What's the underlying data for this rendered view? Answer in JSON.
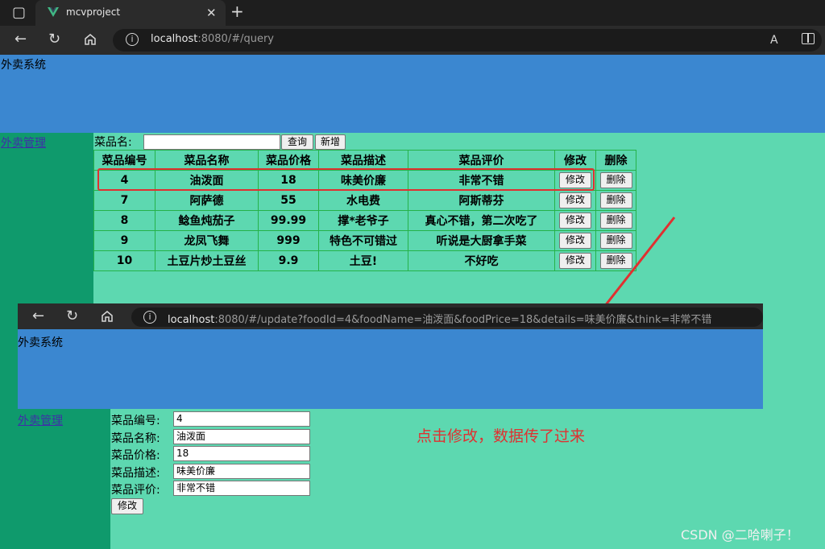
{
  "browser": {
    "tab_title": "mcvproject",
    "url_host": "localhost",
    "url_rest": ":8080/#/query"
  },
  "app": {
    "title": "外卖系统",
    "sidebar_link": "外卖管理"
  },
  "search": {
    "label": "菜品名:",
    "value": "",
    "query_button": "查询",
    "add_button": "新增"
  },
  "table": {
    "headers": [
      "菜品编号",
      "菜品名称",
      "菜品价格",
      "菜品描述",
      "菜品评价",
      "修改",
      "删除"
    ],
    "rows": [
      {
        "id": "4",
        "name": "油泼面",
        "price": "18",
        "desc": "味美价廉",
        "review": "非常不错"
      },
      {
        "id": "7",
        "name": "阿萨德",
        "price": "55",
        "desc": "水电费",
        "review": "阿斯蒂芬"
      },
      {
        "id": "8",
        "name": "鲶鱼炖茄子",
        "price": "99.99",
        "desc": "撑*老爷子",
        "review": "真心不错，第二次吃了"
      },
      {
        "id": "9",
        "name": "龙凤飞舞",
        "price": "999",
        "desc": "特色不可错过",
        "review": "听说是大厨拿手菜"
      },
      {
        "id": "10",
        "name": "土豆片炒土豆丝",
        "price": "9.9",
        "desc": "土豆!",
        "review": "不好吃"
      }
    ],
    "edit_label": "修改",
    "delete_label": "删除"
  },
  "update_view": {
    "url_host": "localhost",
    "url_rest": ":8080/#/update?foodId=4&foodName=油泼面&foodPrice=18&details=味美价廉&think=非常不错",
    "title": "外卖系统",
    "sidebar_link": "外卖管理",
    "fields": [
      {
        "label": "菜品编号:",
        "value": "4"
      },
      {
        "label": "菜品名称:",
        "value": "油泼面"
      },
      {
        "label": "菜品价格:",
        "value": "18"
      },
      {
        "label": "菜品描述:",
        "value": "味美价廉"
      },
      {
        "label": "菜品评价:",
        "value": "非常不错"
      }
    ],
    "submit_button": "修改"
  },
  "annotation": "点击修改，数据传了过来",
  "watermark": "CSDN @二哈喇子！",
  "colors": {
    "highlight": "#e03030",
    "header": "#3b87d0",
    "sidebar": "#0f9a6c",
    "background": "#5dd8b0"
  }
}
